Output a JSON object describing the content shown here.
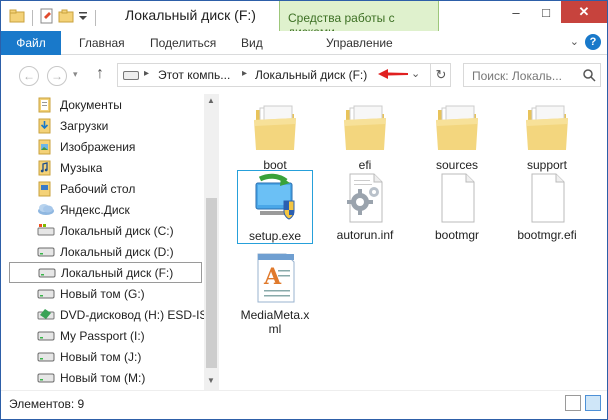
{
  "window": {
    "title": "Локальный диск (F:)",
    "context_tab": "Средства работы с дисками",
    "controls": {
      "minimize": "–",
      "maximize": "□",
      "close": "✕"
    }
  },
  "ribbon": {
    "file_tab": "Файл",
    "tabs": [
      "Главная",
      "Поделиться",
      "Вид",
      "Управление"
    ],
    "collapse_glyph": "⌄",
    "help": "?"
  },
  "address": {
    "crumbs": [
      "Этот компь...",
      "Локальный диск (F:)"
    ],
    "search_placeholder": "Поиск: Локаль..."
  },
  "nav": {
    "items": [
      {
        "label": "Документы",
        "icon": "documents-icon"
      },
      {
        "label": "Загрузки",
        "icon": "downloads-icon"
      },
      {
        "label": "Изображения",
        "icon": "pictures-icon"
      },
      {
        "label": "Музыка",
        "icon": "music-icon"
      },
      {
        "label": "Рабочий стол",
        "icon": "desktop-icon"
      },
      {
        "label": "Яндекс.Диск",
        "icon": "yandex-disk-icon"
      },
      {
        "label": "Локальный диск (C:)",
        "icon": "system-drive-icon"
      },
      {
        "label": "Локальный диск (D:)",
        "icon": "drive-icon"
      },
      {
        "label": "Локальный диск (F:)",
        "icon": "drive-icon",
        "selected": true
      },
      {
        "label": "Новый том (G:)",
        "icon": "drive-icon"
      },
      {
        "label": "DVD-дисковод (H:) ESD-ISO",
        "icon": "dvd-drive-icon"
      },
      {
        "label": "My Passport (I:)",
        "icon": "drive-icon"
      },
      {
        "label": "Новый том (J:)",
        "icon": "drive-icon"
      },
      {
        "label": "Новый том (M:)",
        "icon": "drive-icon"
      }
    ]
  },
  "files": [
    {
      "name": "boot",
      "type": "folder"
    },
    {
      "name": "efi",
      "type": "folder"
    },
    {
      "name": "sources",
      "type": "folder"
    },
    {
      "name": "support",
      "type": "folder"
    },
    {
      "name": "setup.exe",
      "type": "setup",
      "selected": true
    },
    {
      "name": "autorun.inf",
      "type": "inf"
    },
    {
      "name": "bootmgr",
      "type": "blank"
    },
    {
      "name": "bootmgr.efi",
      "type": "blank"
    },
    {
      "name": "MediaMeta.xml",
      "type": "xml"
    }
  ],
  "status": {
    "text": "Элементов: 9"
  },
  "colors": {
    "accent": "#1979ca",
    "context_tab_bg": "#dff1cd",
    "close_btn": "#c7433d",
    "arrow": "#e02020"
  }
}
